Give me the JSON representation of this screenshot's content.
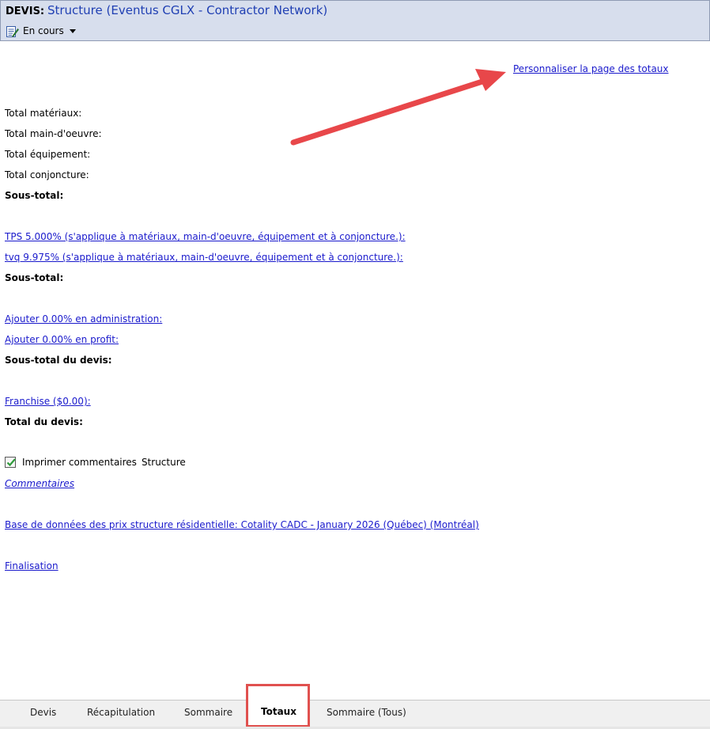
{
  "header": {
    "label": "DEVIS:",
    "name": "Structure (Eventus CGLX - Contractor Network)",
    "status": "En cours",
    "status_icon": "edit-document-icon"
  },
  "customize_link": "Personnaliser la page des totaux",
  "totals": {
    "materials": "Total matériaux:",
    "labor": "Total main-d'oeuvre:",
    "equipment": "Total équipement:",
    "conjuncture": "Total conjoncture:",
    "subtotal1": "Sous-total:",
    "tps": "TPS 5.000% (s'applique à matériaux, main-d'oeuvre, équipement et à conjoncture.):",
    "tvq": "tvq 9.975% (s'applique à matériaux, main-d'oeuvre, équipement et à conjoncture.):",
    "subtotal2": "Sous-total:",
    "admin": "Ajouter 0.00% en administration:",
    "profit": "Ajouter 0.00% en profit:",
    "estimate_subtotal": "Sous-total du devis:",
    "deductible": "Franchise ($0.00):",
    "estimate_total": "Total du devis:"
  },
  "print_comments": {
    "label": "Imprimer commentaires",
    "section": "Structure",
    "checked": true
  },
  "comments_link": "Commentaires",
  "price_db_link": "Base de données des prix structure résidentielle: Cotality CADC - January 2026 (Québec) (Montréal)",
  "finalize_link": "Finalisation",
  "tabs": [
    {
      "label": "Devis"
    },
    {
      "label": "Récapitulation"
    },
    {
      "label": "Sommaire"
    },
    {
      "label": "Totaux",
      "active": true
    },
    {
      "label": "Sommaire (Tous)"
    }
  ],
  "colors": {
    "header_bg": "#d7deed",
    "link": "#1a1acc",
    "annotation": "#e0514f"
  }
}
